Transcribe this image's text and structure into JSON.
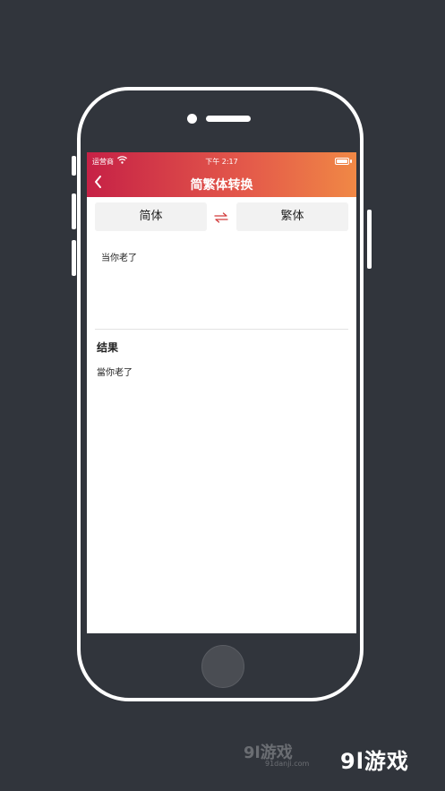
{
  "status_bar": {
    "carrier": "运营商",
    "time": "下午 2:17"
  },
  "header": {
    "title": "简繁体转换"
  },
  "converter": {
    "source_lang": "简体",
    "target_lang": "繁体",
    "input_text": "当你老了"
  },
  "result": {
    "heading": "结果",
    "text": "當你老了"
  },
  "watermark": {
    "brand": "9l游戏",
    "faint_brand": "9l游戏",
    "faint_url": "91danji.com"
  },
  "colors": {
    "background": "#31353c",
    "header_start": "#c62146",
    "header_end": "#f08845",
    "swap_icon": "#d23c3c"
  }
}
